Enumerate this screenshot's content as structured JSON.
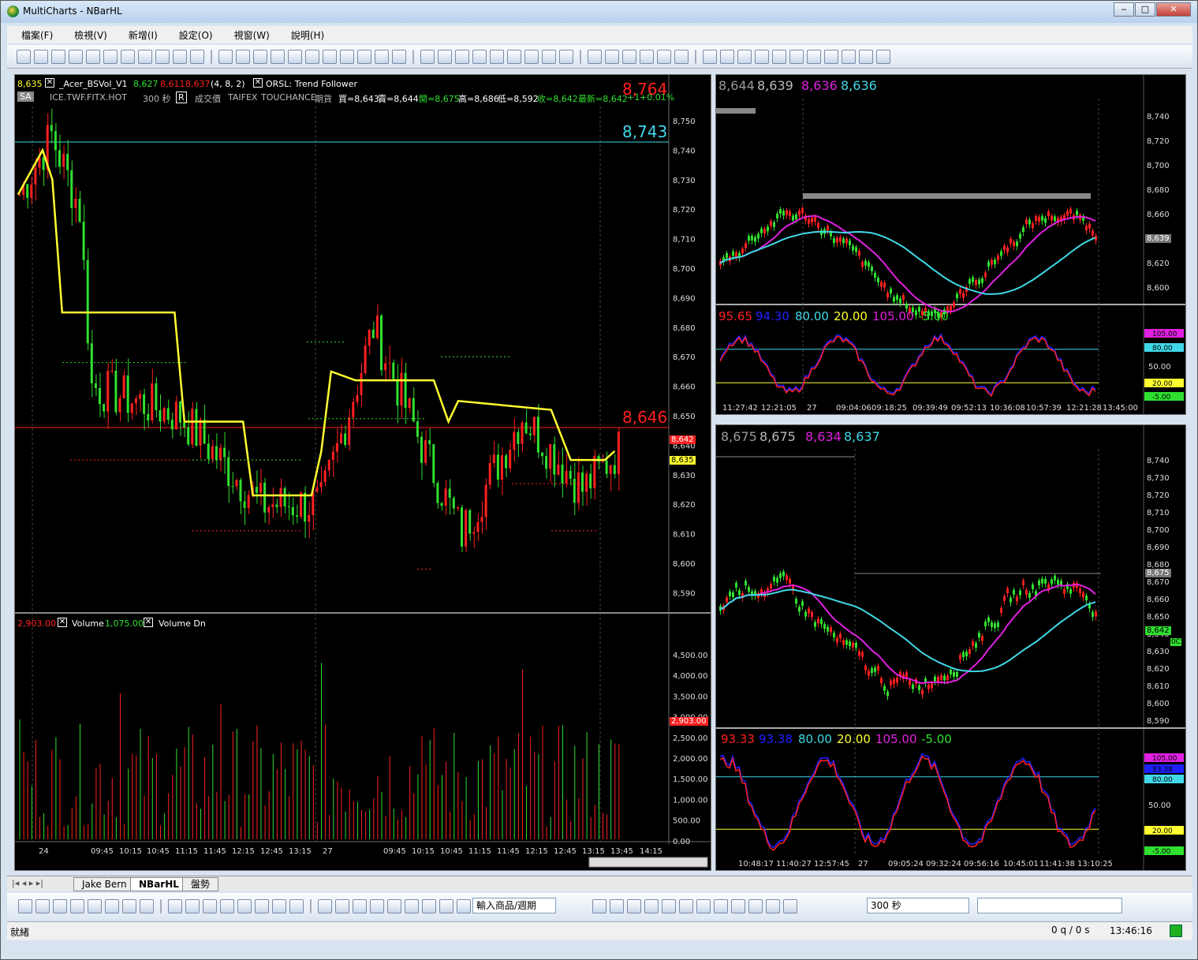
{
  "window": {
    "title": "MultiCharts - NBarHL"
  },
  "menu": [
    "檔案(F)",
    "檢視(V)",
    "新增(I)",
    "設定(O)",
    "視窗(W)",
    "說明(H)"
  ],
  "left_chart": {
    "indicator_line": {
      "price": "8,635",
      "study": "_Acer_BSVol_V1",
      "v1": "8,627",
      "v2": "8,611",
      "v3": "8,637",
      "params": "(4,  8,  2)",
      "study2": "ORSL: Trend Follower"
    },
    "symbol_line": {
      "mode": "SA",
      "symbol": "ICE.TWF.FITX.HOT",
      "interval": "300 秒",
      "r": "R",
      "field": "成交價",
      "exch": "TAIFEX",
      "feed": "TOUCHANCE",
      "type": "期貨",
      "bid": "買=8,643",
      "ask": "賣=8,644",
      "open": "開=8,675",
      "high": "高=8,686",
      "low": "低=8,592",
      "close": "收=8,642",
      "last": "最新=8,642",
      "chg": "+1",
      "pct": "+0.01%"
    },
    "top_price": "8,764",
    "cyan_level": "8,743",
    "red_level": "8,646",
    "last_price_tag": "8,642",
    "yellow_tag": "8,635",
    "axis": [
      "8,750",
      "8,740",
      "8,730",
      "8,720",
      "8,710",
      "8,700",
      "8,690",
      "8,680",
      "8,670",
      "8,660",
      "8,650",
      "8,640",
      "8,630",
      "8,620",
      "8,610",
      "8,600",
      "8,590"
    ],
    "volume": {
      "last": "2,903.00",
      "label_vol": "Volume",
      "vol_val": "1,075.00",
      "label_dn": "Volume Dn",
      "axis": [
        "4,500.00",
        "4,000.00",
        "3,500.00",
        "3,000.00",
        "2,500.00",
        "2,000.00",
        "1,500.00",
        "1,000.00",
        "500.00",
        "0.00"
      ],
      "tag": "2,903.00"
    },
    "time_axis": [
      "24",
      "09:45",
      "10:15",
      "10:45",
      "11:15",
      "11:45",
      "12:15",
      "12:45",
      "13:15",
      "27",
      "09:45",
      "10:15",
      "10:45",
      "11:15",
      "11:45",
      "12:15",
      "12:45",
      "13:15",
      "13:45",
      "14:15"
    ]
  },
  "right_top": {
    "header": [
      "8,644",
      "8,639",
      "8,636",
      "8,636"
    ],
    "axis": [
      "8,740",
      "8,720",
      "8,700",
      "8,680",
      "8,660",
      "8,640",
      "8,620",
      "8,600"
    ],
    "tag": "8,639",
    "osc_header": [
      "95.65",
      "94.30",
      "80.00",
      "20.00",
      "105.00",
      "-5.00"
    ],
    "osc_axis": [
      "80.00",
      "50.00",
      "20.00",
      "-5.00"
    ],
    "osc_tags": [
      "105.00",
      "80.00",
      "20.00",
      "-5.00"
    ],
    "time_axis": [
      "11:27:42",
      "12:21:05",
      "27",
      "09:04:06",
      "09:18:25",
      "09:39:49",
      "09:52:13",
      "10:36:08",
      "10:57:39",
      "12:21:28",
      "13:45:00"
    ]
  },
  "right_bottom": {
    "header": [
      "8,675",
      "8,675",
      "8,634",
      "8,637"
    ],
    "axis": [
      "8,740",
      "8,730",
      "8,720",
      "8,710",
      "8,700",
      "8,690",
      "8,680",
      "8,670",
      "8,660",
      "8,650",
      "8,640",
      "8,630",
      "8,620",
      "8,610",
      "8,600",
      "8,590"
    ],
    "tag": "8,675",
    "tag2": "8,642",
    "tag3": "0C",
    "osc_header": [
      "93.33",
      "93.38",
      "80.00",
      "20.00",
      "105.00",
      "-5.00"
    ],
    "osc_axis": [
      "50.00"
    ],
    "osc_tags": [
      "105.00",
      "93.38",
      "80.00",
      "20.00",
      "-5.00"
    ],
    "time_axis": [
      "10:48:17",
      "11:40:27",
      "12:57:45",
      "27",
      "09:05:24",
      "09:32:24",
      "09:56:16",
      "10:45:01",
      "11:41:38",
      "13:10:25"
    ]
  },
  "tabs": [
    "Jake Bern",
    "NBarHL",
    "盤勢"
  ],
  "drawbar": {
    "symbol_combo": "輸入商品/週期",
    "interval_combo": "300 秒"
  },
  "status": {
    "left": "就緒",
    "orders": "0 q / 0 s",
    "time": "13:46:16"
  },
  "colors": {
    "up": "#ff2020",
    "down": "#30e030",
    "yellow": "#ffff30",
    "cyan": "#40d8e8",
    "magenta": "#e020e0"
  }
}
